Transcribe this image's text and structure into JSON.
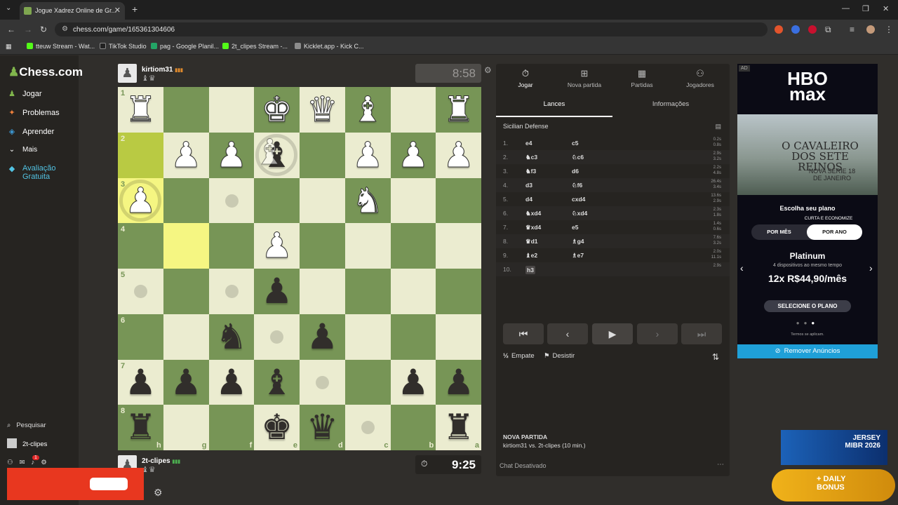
{
  "browser": {
    "tab_title": "Jogue Xadrez Online de Gr...",
    "url": "chess.com/game/165361304606",
    "bookmarks": [
      {
        "label": "tteuw Stream - Wat...",
        "color": "#53fc18"
      },
      {
        "label": "TikTok Studio",
        "color": "#222222"
      },
      {
        "label": "pag - Google Planil...",
        "color": "#23a566"
      },
      {
        "label": "2t_clipes Stream -...",
        "color": "#53fc18"
      },
      {
        "label": "Kicklet.app - Kick C...",
        "color": "#8c8c8c"
      }
    ]
  },
  "sidebar": {
    "logo": "Chess.com",
    "items": [
      {
        "label": "Jogar",
        "icon": "play-board-icon",
        "glyph": "♟"
      },
      {
        "label": "Problemas",
        "icon": "puzzle-icon",
        "glyph": "✦"
      },
      {
        "label": "Aprender",
        "icon": "graduation-cap-icon",
        "glyph": "🎓"
      },
      {
        "label": "Mais",
        "icon": "chevron-down-icon",
        "glyph": "⌄"
      },
      {
        "label": "Avaliação Gratuita",
        "icon": "diamond-icon",
        "glyph": "◆"
      }
    ],
    "search_label": "Pesquisar",
    "user_label": "2t-clipes",
    "notification_count": "1"
  },
  "top_player": {
    "name": "kirtiom31",
    "flag_bars": "▮▮▮",
    "captured": "♝♛",
    "clock": "8:58"
  },
  "bottom_player": {
    "name": "2t-clipes",
    "flag_bars": "▮▮▮",
    "captured": "♝♛",
    "clock": "9:25"
  },
  "board": {
    "ranks": [
      "1",
      "2",
      "3",
      "4",
      "5",
      "6",
      "7",
      "8"
    ],
    "files": [
      "h",
      "g",
      "f",
      "e",
      "d",
      "c",
      "b",
      "a"
    ],
    "light_color": "#ebecd0",
    "dark_color": "#779556",
    "highlight_color": "#f5f682",
    "squares": [
      [
        "wR",
        "",
        "",
        "wK",
        "wQ",
        "wB",
        "",
        "wR"
      ],
      [
        "",
        "wP",
        "wP",
        "bB+wB",
        "",
        "wP",
        "wP",
        "wP"
      ],
      [
        "wP",
        "",
        "",
        "",
        "",
        "wN",
        "",
        ""
      ],
      [
        "",
        "",
        "",
        "wP",
        "",
        "",
        "",
        ""
      ],
      [
        "",
        "",
        "",
        "bP",
        "",
        "",
        "",
        ""
      ],
      [
        "",
        "",
        "bN",
        "",
        "bP",
        "",
        "",
        ""
      ],
      [
        "bP",
        "bP",
        "bP",
        "bB",
        "",
        "",
        "bP",
        "bP"
      ],
      [
        "bR",
        "",
        "",
        "bK",
        "bQ",
        "",
        "",
        "bR"
      ]
    ]
  },
  "panel": {
    "tabs": [
      {
        "label": "Jogar",
        "icon": "stopwatch-icon",
        "glyph": "⏱"
      },
      {
        "label": "Nova partida",
        "icon": "plus-square-icon",
        "glyph": "⊞"
      },
      {
        "label": "Partidas",
        "icon": "board-icon",
        "glyph": "▦"
      },
      {
        "label": "Jogadores",
        "icon": "players-icon",
        "glyph": "👥"
      }
    ],
    "subtabs": [
      "Lances",
      "Informações"
    ],
    "opening": "Sicilian Defense",
    "moves": [
      {
        "n": "1.",
        "w": "e4",
        "b": "c5",
        "tw": "0.2s",
        "tb": "0.8s"
      },
      {
        "n": "2.",
        "w": "♞c3",
        "b": "♘c6",
        "tw": "2.9s",
        "tb": "3.2s"
      },
      {
        "n": "3.",
        "w": "♞f3",
        "b": "d6",
        "tw": "2.2s",
        "tb": "4.8s"
      },
      {
        "n": "4.",
        "w": "d3",
        "b": "♘f6",
        "tw": "26.4s",
        "tb": "3.4s"
      },
      {
        "n": "5.",
        "w": "d4",
        "b": "cxd4",
        "tw": "13.6s",
        "tb": "2.9s"
      },
      {
        "n": "6.",
        "w": "♞xd4",
        "b": "♘xd4",
        "tw": "2.3s",
        "tb": "1.8s"
      },
      {
        "n": "7.",
        "w": "♛xd4",
        "b": "e5",
        "tw": "1.4s",
        "tb": "0.6s"
      },
      {
        "n": "8.",
        "w": "♛d1",
        "b": "♗g4",
        "tw": "7.6s",
        "tb": "3.2s"
      },
      {
        "n": "9.",
        "w": "♝e2",
        "b": "♗e7",
        "tw": "2.0s",
        "tb": "11.1s"
      },
      {
        "n": "10.",
        "w": "h3",
        "b": "",
        "tw": "2.9s",
        "tb": ""
      }
    ],
    "draw_label": "Empate",
    "resign_label": "Desistir",
    "new_game_title": "NOVA PARTIDA",
    "new_game_sub": "kirtiom31 vs. 2t-clipes (10 min.)",
    "chat_label": "Chat Desativado"
  },
  "ad": {
    "tag": "AD",
    "brand_line1": "HBO",
    "brand_line2": "max",
    "show_title": "O CAVALEIRO DOS SETE REINOS",
    "show_date": "NOVA SERIE 18 DE JANEIRO",
    "plan_heading": "Escolha seu plano",
    "promo": "CURTA E ECONOMIZE",
    "toggle_left": "POR MÊS",
    "toggle_right": "POR ANO",
    "plan_name": "Platinum",
    "plan_desc": "4 dispositivos ao mesmo tempo",
    "price": "12x R$44,90/mês",
    "cta": "SELECIONE O PLANO",
    "terms": "Termos se aplicam.",
    "remove_ads": "Remover Anúncios"
  },
  "overlays": {
    "mibr_line1": "JERSEY",
    "mibr_line2": "MIBR 2026",
    "bonus_line1": "+ DAILY",
    "bonus_line2": "BONUS"
  }
}
